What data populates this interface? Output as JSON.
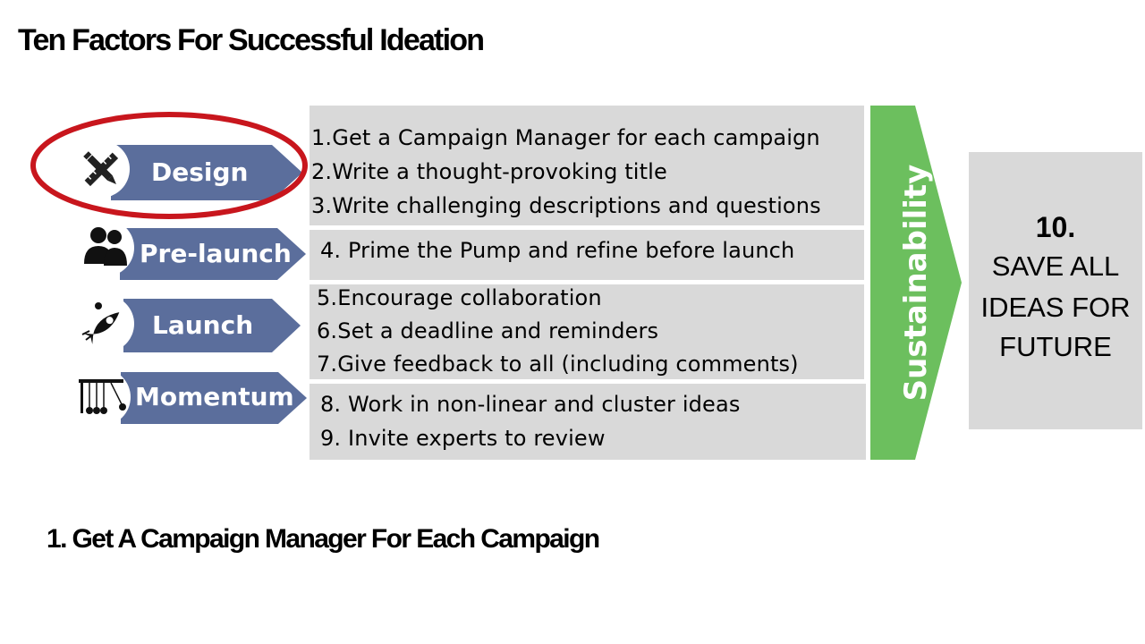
{
  "title": "Ten Factors For Successful Ideation",
  "stages": [
    {
      "label": "Design",
      "icon": "pencil-ruler-icon"
    },
    {
      "label": "Pre-launch",
      "icon": "team-icon"
    },
    {
      "label": "Launch",
      "icon": "rocket-icon"
    },
    {
      "label": "Momentum",
      "icon": "newtons-cradle-icon"
    }
  ],
  "factors": {
    "design": [
      "1.Get a Campaign Manager for each campaign",
      "2.Write a thought-provoking title",
      "3.Write challenging descriptions and questions"
    ],
    "prelaunch": [
      "4. Prime the Pump and refine before launch"
    ],
    "launch": [
      "5.Encourage collaboration",
      "6.Set a deadline and reminders",
      "7.Give feedback to all (including comments)"
    ],
    "momentum": [
      "8. Work in non-linear and cluster ideas",
      "9. Invite experts to review"
    ]
  },
  "sustainability": "Sustainability",
  "final": {
    "number": "10.",
    "lines": [
      "SAVE ALL",
      "IDEAS FOR",
      "FUTURE"
    ]
  },
  "subtitle": "1. Get A Campaign Manager For Each Campaign",
  "colors": {
    "stage_fill": "#5b6e9c",
    "box_fill": "#d9d9d9",
    "sustain_fill": "#6cbf5e",
    "highlight_ring": "#c8161d"
  }
}
